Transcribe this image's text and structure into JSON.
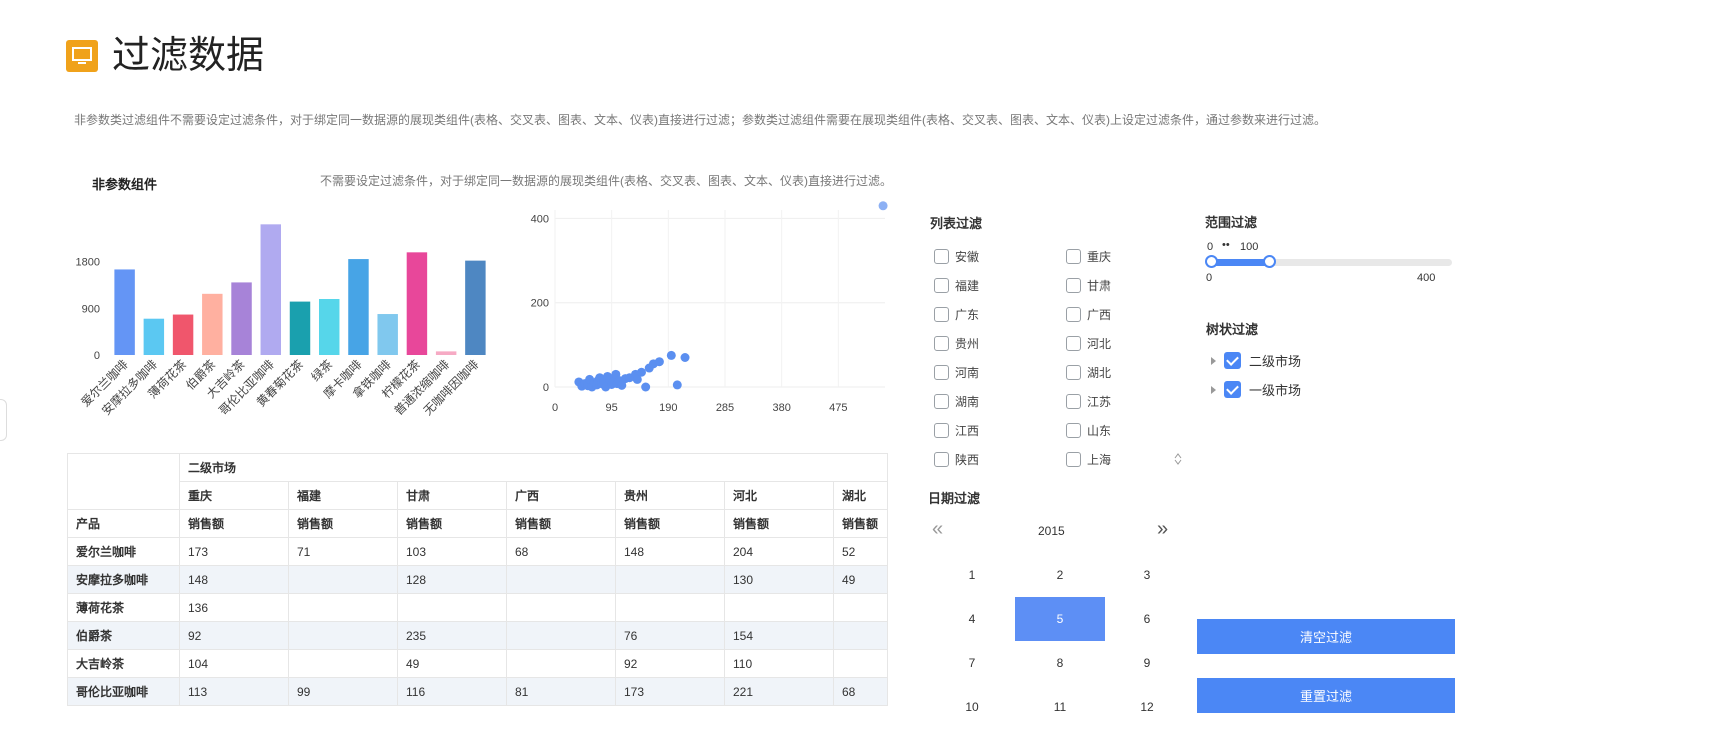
{
  "page": {
    "title": "过滤数据",
    "description": "非参数类过滤组件不需要设定过滤条件，对于绑定同一数据源的展现类组件(表格、交叉表、图表、文本、仪表)直接进行过滤；参数类过滤组件需要在展现类组件(表格、交叉表、图表、文本、仪表)上设定过滤条件，通过参数来进行过滤。",
    "section_title": "非参数组件",
    "section_desc": "不需要设定过滤条件，对于绑定同一数据源的展现类组件(表格、交叉表、图表、文本、仪表)直接进行过滤。"
  },
  "chart_data": [
    {
      "type": "bar",
      "categories": [
        "爱尔兰咖啡",
        "安摩拉多咖啡",
        "薄荷花茶",
        "伯爵茶",
        "大吉岭茶",
        "哥伦比亚咖啡",
        "黄春菊花茶",
        "绿茶",
        "摩卡咖啡",
        "拿铁咖啡",
        "柠檬花茶",
        "普通浓缩咖啡",
        "无咖啡因咖啡"
      ],
      "values": [
        1650,
        700,
        780,
        1180,
        1400,
        2520,
        1030,
        1080,
        1850,
        790,
        1980,
        70,
        1820
      ],
      "colors": [
        "#6495f5",
        "#5bc8f2",
        "#f0566c",
        "#ffb0a0",
        "#a783d8",
        "#b0aaf0",
        "#1aa0ae",
        "#56d6ea",
        "#47a4e6",
        "#80c8ee",
        "#e8479a",
        "#f6aac4",
        "#4e87c2"
      ],
      "ylim": [
        0,
        2700
      ],
      "yticks": [
        0,
        900,
        1800
      ]
    },
    {
      "type": "scatter",
      "color": "#5b8ff0",
      "xlim": [
        0,
        570
      ],
      "ylim": [
        0,
        420
      ],
      "xticks": [
        0,
        95,
        190,
        285,
        380,
        475
      ],
      "yticks": [
        0,
        200,
        400
      ],
      "points": [
        [
          40,
          12
        ],
        [
          45,
          2
        ],
        [
          50,
          8
        ],
        [
          55,
          3
        ],
        [
          58,
          18
        ],
        [
          62,
          0
        ],
        [
          66,
          10
        ],
        [
          70,
          5
        ],
        [
          72,
          15
        ],
        [
          75,
          22
        ],
        [
          78,
          8
        ],
        [
          82,
          12
        ],
        [
          85,
          0
        ],
        [
          88,
          25
        ],
        [
          92,
          18
        ],
        [
          95,
          6
        ],
        [
          98,
          12
        ],
        [
          102,
          30
        ],
        [
          104,
          8
        ],
        [
          108,
          15
        ],
        [
          112,
          4
        ],
        [
          118,
          20
        ],
        [
          125,
          22
        ],
        [
          135,
          30
        ],
        [
          138,
          18
        ],
        [
          145,
          35
        ],
        [
          152,
          0
        ],
        [
          158,
          45
        ],
        [
          165,
          55
        ],
        [
          175,
          60
        ],
        [
          195,
          75
        ],
        [
          205,
          5
        ],
        [
          218,
          70
        ],
        [
          550,
          430
        ]
      ]
    }
  ],
  "list_filter": {
    "title": "列表过滤",
    "col1": [
      "安徽",
      "福建",
      "广东",
      "贵州",
      "河南",
      "湖南",
      "江西",
      "陕西"
    ],
    "col2": [
      "重庆",
      "甘肃",
      "广西",
      "河北",
      "湖北",
      "江苏",
      "山东",
      "上海"
    ]
  },
  "range_filter": {
    "title": "范围过滤",
    "value_low": "0",
    "value_high": "100",
    "min": "0",
    "max": "400",
    "fraction_low": 0,
    "fraction_high": 0.25
  },
  "tree_filter": {
    "title": "树状过滤",
    "items": [
      "二级市场",
      "一级市场"
    ]
  },
  "date_filter": {
    "title": "日期过滤",
    "year": "2015",
    "prev": "«",
    "next": "»",
    "months": [
      "1",
      "2",
      "3",
      "4",
      "5",
      "6",
      "7",
      "8",
      "9",
      "10",
      "11",
      "12"
    ],
    "selected": "5"
  },
  "buttons": {
    "clear": "清空过滤",
    "reset": "重置过滤"
  },
  "table": {
    "market": "二级市场",
    "regions": [
      "重庆",
      "福建",
      "甘肃",
      "广西",
      "贵州",
      "河北",
      "湖北"
    ],
    "product_header": "产品",
    "measure": "销售额",
    "rows": [
      {
        "name": "爱尔兰咖啡",
        "values": [
          "173",
          "71",
          "103",
          "68",
          "148",
          "204",
          "52"
        ]
      },
      {
        "name": "安摩拉多咖啡",
        "values": [
          "148",
          "",
          "128",
          "",
          "",
          "130",
          "49"
        ]
      },
      {
        "name": "薄荷花茶",
        "values": [
          "136",
          "",
          "",
          "",
          "",
          "",
          ""
        ]
      },
      {
        "name": "伯爵茶",
        "values": [
          "92",
          "",
          "235",
          "",
          "76",
          "154",
          ""
        ]
      },
      {
        "name": "大吉岭茶",
        "values": [
          "104",
          "",
          "49",
          "",
          "92",
          "110",
          ""
        ]
      },
      {
        "name": "哥伦比亚咖啡",
        "values": [
          "113",
          "99",
          "116",
          "81",
          "173",
          "221",
          "68"
        ]
      }
    ]
  }
}
